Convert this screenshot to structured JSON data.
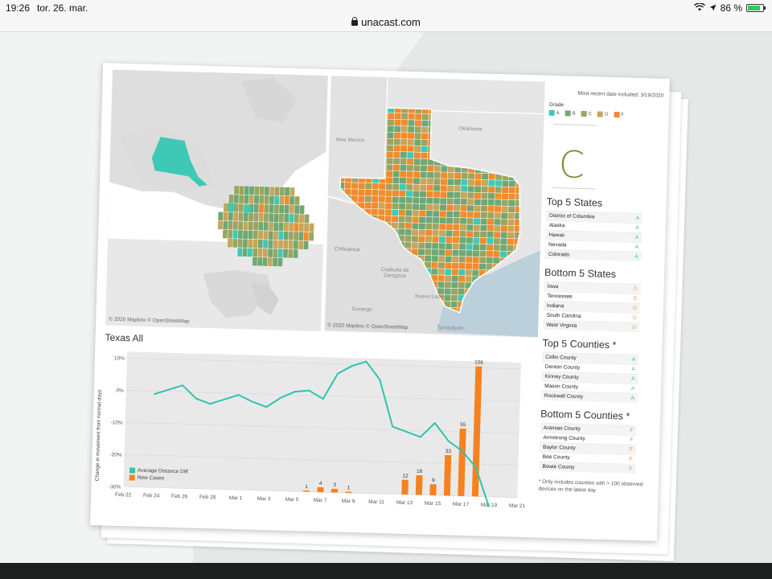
{
  "status_bar": {
    "time": "19:26",
    "date": "tor. 26. mar.",
    "battery": "86 %",
    "battery_level": 0.86
  },
  "browser": {
    "url": "unacast.com"
  },
  "map_credit": "© 2020 Mapbox © OpenStreetMap",
  "map_labels": {
    "new_mexico": "New Mexico",
    "oklahoma": "Oklahoma",
    "chihuahua": "Chihuahua",
    "coahuila": "Coahuila de Zaragoza",
    "durango": "Durango",
    "nuevo_leon": "Nuevo León",
    "tamaulipas": "Tamaulipas"
  },
  "panel": {
    "most_recent": "Most recent date included: 3/19/2020",
    "grade_title": "Grade",
    "grade_legend": [
      {
        "label": "A",
        "color": "#3ec9b6"
      },
      {
        "label": "B",
        "color": "#6fa873"
      },
      {
        "label": "C",
        "color": "#9aa561"
      },
      {
        "label": "D",
        "color": "#c8a559"
      },
      {
        "label": "F",
        "color": "#f28b2c"
      }
    ],
    "overall_grade": "C",
    "top_states_title": "Top 5 States",
    "top_states": [
      {
        "name": "District of Columbia",
        "grade": "A"
      },
      {
        "name": "Alaska",
        "grade": "A"
      },
      {
        "name": "Hawaii",
        "grade": "A"
      },
      {
        "name": "Nevada",
        "grade": "A"
      },
      {
        "name": "Colorado",
        "grade": "A"
      }
    ],
    "bottom_states_title": "Bottom 5 States",
    "bottom_states": [
      {
        "name": "Iowa",
        "grade": "D"
      },
      {
        "name": "Tennessee",
        "grade": "D"
      },
      {
        "name": "Indiana",
        "grade": "D"
      },
      {
        "name": "South Carolina",
        "grade": "D"
      },
      {
        "name": "West Virginia",
        "grade": "D"
      }
    ],
    "top_counties_title": "Top 5 Counties *",
    "top_counties": [
      {
        "name": "Collin County",
        "grade": "A"
      },
      {
        "name": "Denton County",
        "grade": "A"
      },
      {
        "name": "Kinney County",
        "grade": "A"
      },
      {
        "name": "Mason County",
        "grade": "A"
      },
      {
        "name": "Rockwall County",
        "grade": "A"
      }
    ],
    "bottom_counties_title": "Bottom 5 Counties *",
    "bottom_counties": [
      {
        "name": "Aransas County",
        "grade": "F"
      },
      {
        "name": "Armstrong County",
        "grade": "F"
      },
      {
        "name": "Baylor County",
        "grade": "F"
      },
      {
        "name": "Bee County",
        "grade": "F"
      },
      {
        "name": "Bowie County",
        "grade": "F"
      }
    ],
    "footnote": "* Only includes counties with > 100 observed devices on the latest day"
  },
  "chart_title": "Texas All",
  "chart_data": {
    "type": "bar",
    "title": "",
    "ylabel": "Change in movement from normal days",
    "ylim": [
      -30,
      12
    ],
    "yticks": [
      "10%",
      "0%",
      "-10%",
      "-20%",
      "-30%"
    ],
    "ytick_values": [
      10,
      0,
      -10,
      -20,
      -30
    ],
    "xticks": [
      "Feb 22",
      "Feb 24",
      "Feb 26",
      "Feb 28",
      "Mar 1",
      "Mar 3",
      "Mar 5",
      "Mar 7",
      "Mar 9",
      "Mar 11",
      "Mar 13",
      "Mar 15",
      "Mar 17",
      "Mar 19",
      "Mar 21"
    ],
    "legend": [
      "Average Distance Diff",
      "New Cases"
    ],
    "colors": {
      "line": "#2ec4b0",
      "bars": "#f5821f"
    },
    "x_start": "2020-02-22",
    "x_end": "2020-03-21",
    "line_series": {
      "name": "Average Distance Diff",
      "x": [
        "2020-02-24",
        "2020-02-25",
        "2020-02-26",
        "2020-02-27",
        "2020-02-28",
        "2020-02-29",
        "2020-03-01",
        "2020-03-02",
        "2020-03-03",
        "2020-03-04",
        "2020-03-05",
        "2020-03-06",
        "2020-03-07",
        "2020-03-08",
        "2020-03-09",
        "2020-03-10",
        "2020-03-11",
        "2020-03-12",
        "2020-03-13",
        "2020-03-14",
        "2020-03-15",
        "2020-03-16",
        "2020-03-17",
        "2020-03-18",
        "2020-03-19"
      ],
      "values": [
        -1,
        0.5,
        2,
        -2,
        -3.5,
        -2,
        -0.5,
        -2.5,
        -4,
        -1,
        1,
        1.5,
        -1,
        7,
        9.5,
        11,
        5.5,
        -9,
        -10.5,
        -12,
        -7.5,
        -13,
        -16,
        -21,
        -33
      ]
    },
    "bar_series": {
      "name": "New Cases",
      "x": [
        "2020-03-06",
        "2020-03-07",
        "2020-03-08",
        "2020-03-09",
        "2020-03-13",
        "2020-03-14",
        "2020-03-15",
        "2020-03-16",
        "2020-03-17",
        "2020-03-18",
        "2020-03-19"
      ],
      "values": [
        1,
        4,
        3,
        1,
        12,
        16,
        9,
        33,
        55,
        106,
        0
      ],
      "labels": [
        "1",
        "4",
        "3",
        "1",
        "12",
        "16",
        "9",
        "33",
        "55",
        "106",
        ""
      ]
    }
  }
}
